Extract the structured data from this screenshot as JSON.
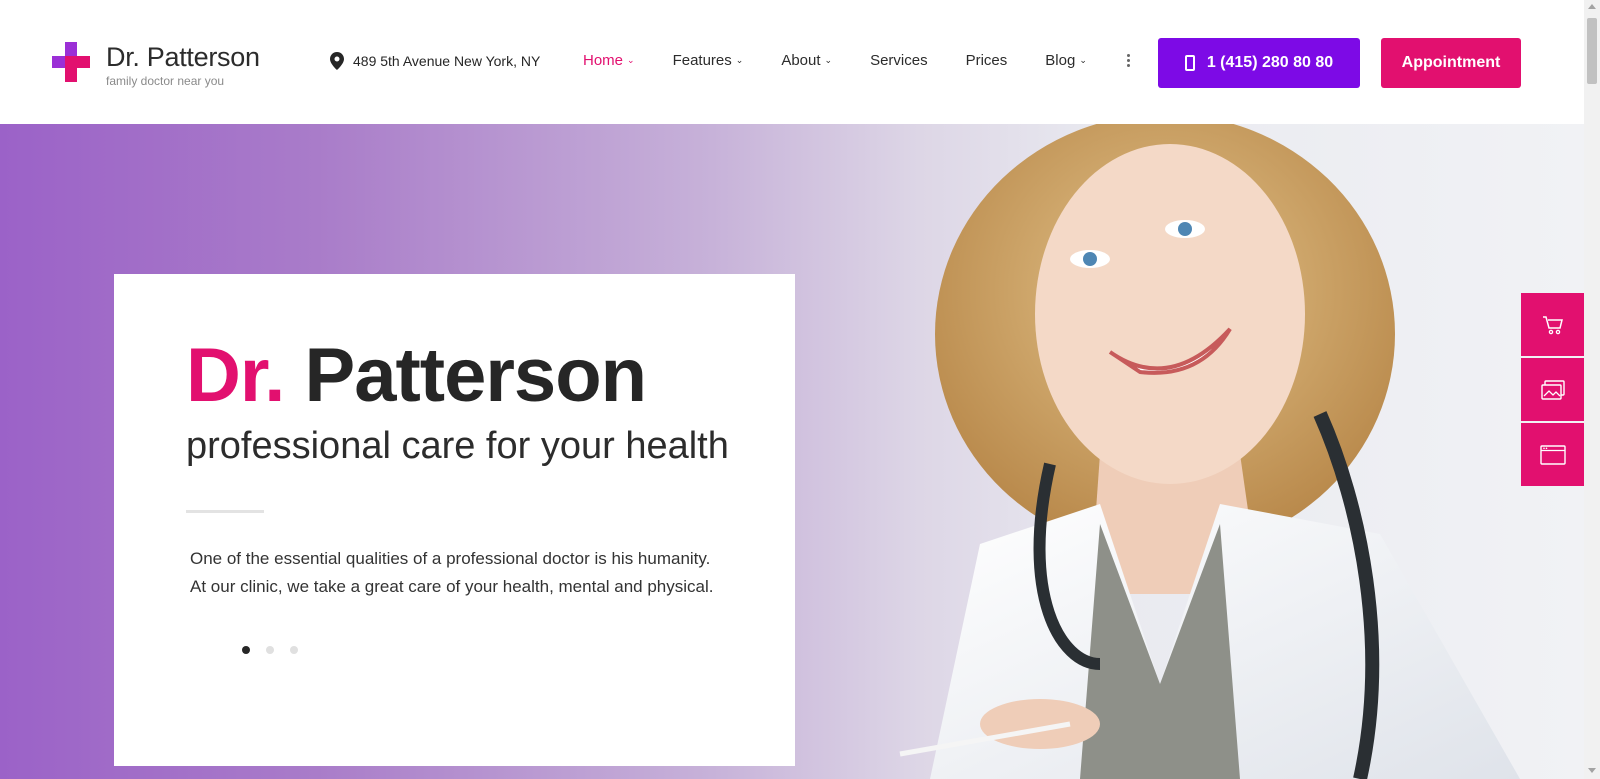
{
  "brand": {
    "name": "Dr. Patterson",
    "tagline": "family doctor near you"
  },
  "header": {
    "address": "489 5th Avenue New York, NY",
    "nav": [
      {
        "label": "Home",
        "has_dropdown": true,
        "active": true
      },
      {
        "label": "Features",
        "has_dropdown": true,
        "active": false
      },
      {
        "label": "About",
        "has_dropdown": true,
        "active": false
      },
      {
        "label": "Services",
        "has_dropdown": false,
        "active": false
      },
      {
        "label": "Prices",
        "has_dropdown": false,
        "active": false
      },
      {
        "label": "Blog",
        "has_dropdown": true,
        "active": false
      }
    ],
    "chevron": "⌄",
    "phone_label": "1 (415) 280 80 80",
    "appointment_label": "Appointment"
  },
  "hero": {
    "title_accent": "Dr.",
    "title_main": " Patterson",
    "subtitle": "professional care for your health",
    "description": "One of the essential qualities of a professional doctor is his humanity. At our clinic, we take a great care of your health, mental and physical.",
    "slides_total": 3,
    "active_slide": 1
  },
  "side_buttons": [
    {
      "icon": "cart-icon"
    },
    {
      "icon": "images-icon"
    },
    {
      "icon": "browser-window-icon"
    }
  ],
  "colors": {
    "accent_pink": "#e2106f",
    "accent_purple": "#7d0ae6",
    "text_dark": "#262626"
  }
}
